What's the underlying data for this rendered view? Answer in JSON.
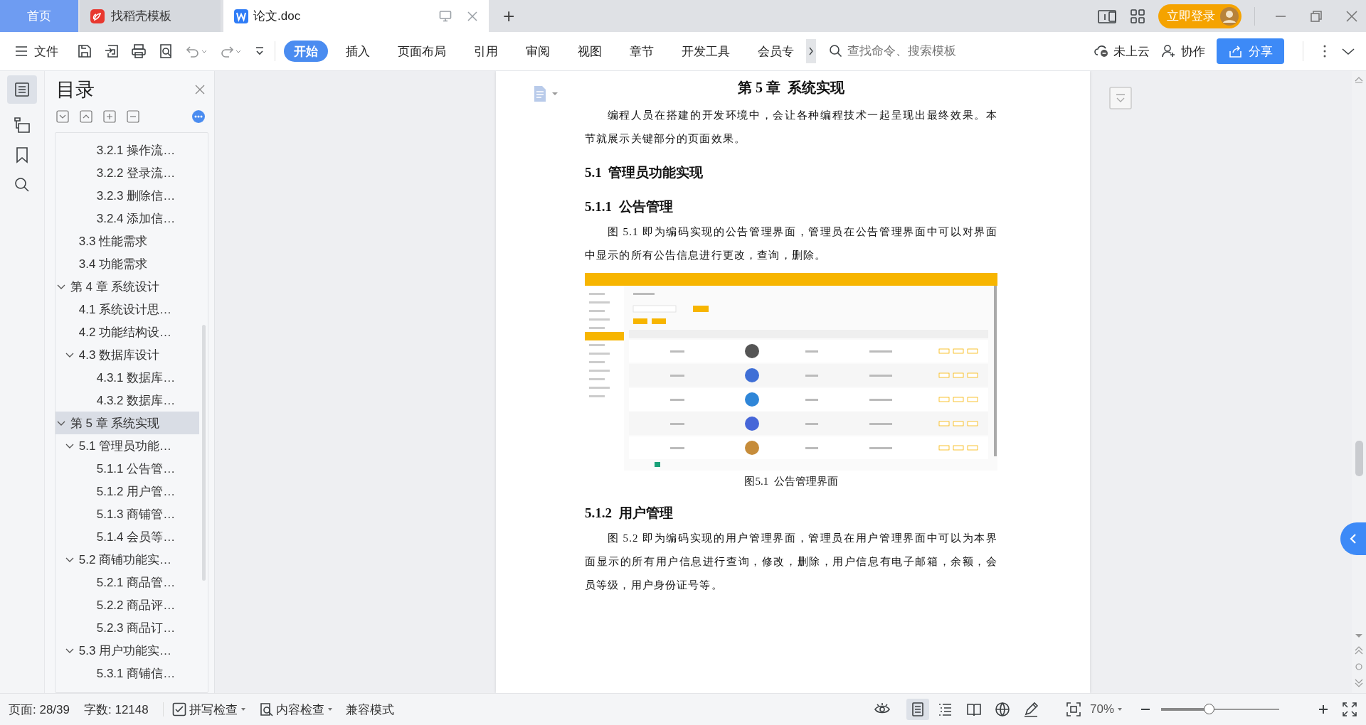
{
  "title_bar": {
    "tabs": [
      {
        "kind": "home",
        "label": "首页",
        "selected": false
      },
      {
        "kind": "template",
        "label": "找稻壳模板",
        "selected": false
      },
      {
        "kind": "document",
        "label": "论文.doc",
        "selected": true
      }
    ],
    "new_tab": "+",
    "login_button": "立即登录"
  },
  "ribbon": {
    "file_menu": "文件",
    "tabs": [
      {
        "label": "开始",
        "selected": true
      },
      {
        "label": "插入",
        "selected": false
      },
      {
        "label": "页面布局",
        "selected": false
      },
      {
        "label": "引用",
        "selected": false
      },
      {
        "label": "审阅",
        "selected": false
      },
      {
        "label": "视图",
        "selected": false
      },
      {
        "label": "章节",
        "selected": false
      },
      {
        "label": "开发工具",
        "selected": false
      },
      {
        "label": "会员专",
        "selected": false
      }
    ],
    "search": {
      "placeholder": "查找命令、搜索模板"
    },
    "cloud_status": "未上云",
    "collaborate": "协作",
    "share": "分享"
  },
  "sidebar": {
    "title": "目录",
    "outline": [
      {
        "children": [
          {
            "children": [
              {
                "label": "3.2.1 操作流…",
                "selected": false
              },
              {
                "label": "3.2.2 登录流…",
                "selected": false
              },
              {
                "label": "3.2.3 删除信…",
                "selected": false
              },
              {
                "label": "3.2.4 添加信…",
                "selected": false
              }
            ]
          },
          {
            "label": "3.3 性能需求",
            "selected": false
          },
          {
            "label": "3.4 功能需求",
            "selected": false
          }
        ]
      },
      {
        "label": "第 4 章 系统设计",
        "selected": false,
        "expanded": true,
        "children": [
          {
            "label": "4.1 系统设计思…",
            "selected": false
          },
          {
            "label": "4.2 功能结构设…",
            "selected": false
          },
          {
            "label": "4.3 数据库设计",
            "selected": false,
            "expanded": true,
            "children": [
              {
                "label": "4.3.1 数据库…",
                "selected": false
              },
              {
                "label": "4.3.2 数据库…",
                "selected": false
              }
            ]
          }
        ]
      },
      {
        "label": "第 5 章 系统实现",
        "selected": true,
        "expanded": true,
        "children": [
          {
            "label": "5.1 管理员功能…",
            "selected": false,
            "expanded": true,
            "children": [
              {
                "label": "5.1.1 公告管…",
                "selected": false
              },
              {
                "label": "5.1.2 用户管…",
                "selected": false
              },
              {
                "label": "5.1.3 商铺管…",
                "selected": false
              },
              {
                "label": "5.1.4 会员等…",
                "selected": false
              }
            ]
          },
          {
            "label": "5.2 商铺功能实…",
            "selected": false,
            "expanded": true,
            "children": [
              {
                "label": "5.2.1 商品管…",
                "selected": false
              },
              {
                "label": "5.2.2 商品评…",
                "selected": false
              },
              {
                "label": "5.2.3 商品订…",
                "selected": false
              }
            ]
          },
          {
            "label": "5.3 用户功能实…",
            "selected": false,
            "expanded": true,
            "children": [
              {
                "label": "5.3.1 商铺信…",
                "selected": false
              }
            ]
          }
        ]
      }
    ]
  },
  "document": {
    "blocks": [
      {
        "kind": "chapter",
        "text": "第 5 章  系统实现"
      },
      {
        "kind": "paragraph",
        "text": "编程人员在搭建的开发环境中，会让各种编程技术一起呈现出最终效果。本节就展示关键部分的页面效果。"
      },
      {
        "kind": "section",
        "text": "5.1  管理员功能实现"
      },
      {
        "kind": "subsection",
        "text": "5.1.1  公告管理"
      },
      {
        "kind": "paragraph",
        "text": "图 5.1 即为编码实现的公告管理界面，管理员在公告管理界面中可以对界面中显示的所有公告信息进行更改，查询，删除。"
      },
      {
        "kind": "figure",
        "caption": "图5.1  公告管理界面"
      },
      {
        "kind": "subsection",
        "text": "5.1.2  用户管理"
      },
      {
        "kind": "paragraph",
        "text": "图 5.2 即为编码实现的用户管理界面，管理员在用户管理界面中可以为本界面显示的所有用户信息进行查询，修改，删除，用户信息有电子邮箱，余额，会员等级，用户身份证号等。"
      }
    ]
  },
  "status_bar": {
    "page": "页面: 28/39",
    "words": "字数: 12148",
    "spell_check": "拼写检查",
    "content_check": "内容检查",
    "compat_mode": "兼容模式",
    "view_modes": [
      {
        "kind": "page",
        "selected": true
      },
      {
        "kind": "outline",
        "selected": false
      },
      {
        "kind": "reading",
        "selected": false
      },
      {
        "kind": "web",
        "selected": false
      },
      {
        "kind": "pen",
        "selected": false
      }
    ],
    "zoom": "70%",
    "zoom_slider": {
      "level": 0.41
    }
  }
}
